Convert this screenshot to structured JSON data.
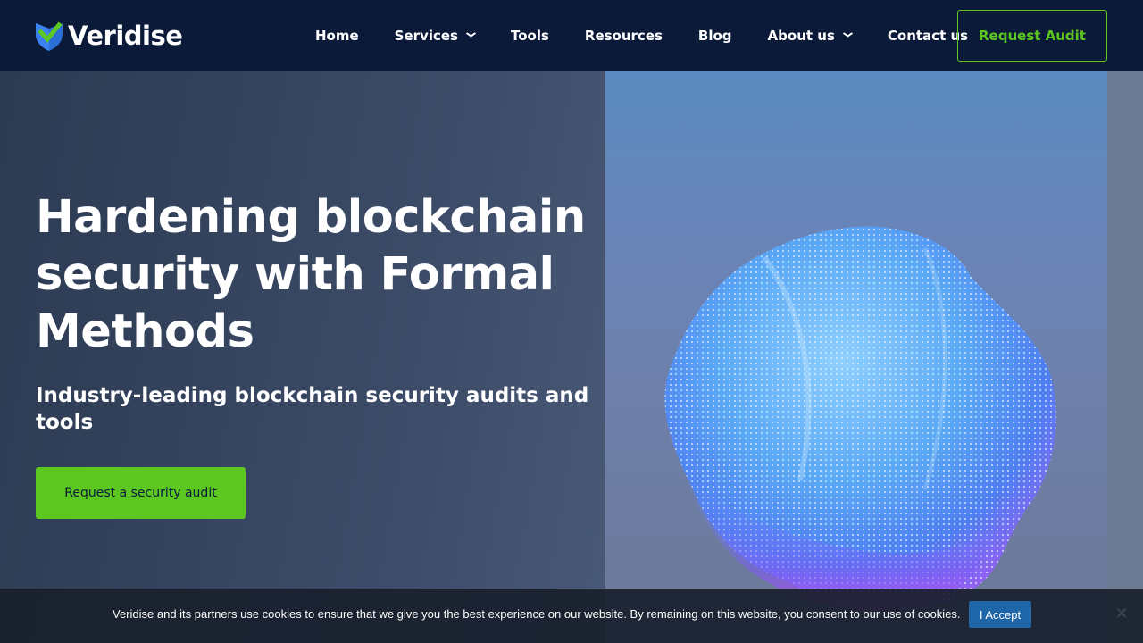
{
  "header": {
    "logo_text": "Veridise",
    "nav": [
      {
        "label": "Home",
        "has_dropdown": false
      },
      {
        "label": "Services",
        "has_dropdown": true
      },
      {
        "label": "Tools",
        "has_dropdown": false
      },
      {
        "label": "Resources",
        "has_dropdown": false
      },
      {
        "label": "Blog",
        "has_dropdown": false
      },
      {
        "label": "About us",
        "has_dropdown": true
      },
      {
        "label": "Contact us",
        "has_dropdown": false
      }
    ],
    "request_audit_label": "Request Audit"
  },
  "hero": {
    "title": "Hardening blockchain security with Formal Methods",
    "subtitle": "Industry-leading blockchain security audits and tools",
    "cta_label": "Request a security audit"
  },
  "cookie": {
    "text": "Veridise and its partners use cookies to ensure that we give you the best experience on our website. By remaining on this website, you consent to our use of cookies.",
    "accept_label": "I Accept",
    "close_symbol": "✕"
  },
  "colors": {
    "brand_green": "#5dc722",
    "header_bg": "#0c1a3a",
    "accept_blue": "#1e66a8"
  },
  "icons": {
    "logo": "shield-check-icon",
    "dropdown": "chevron-down-icon",
    "close": "close-icon"
  }
}
